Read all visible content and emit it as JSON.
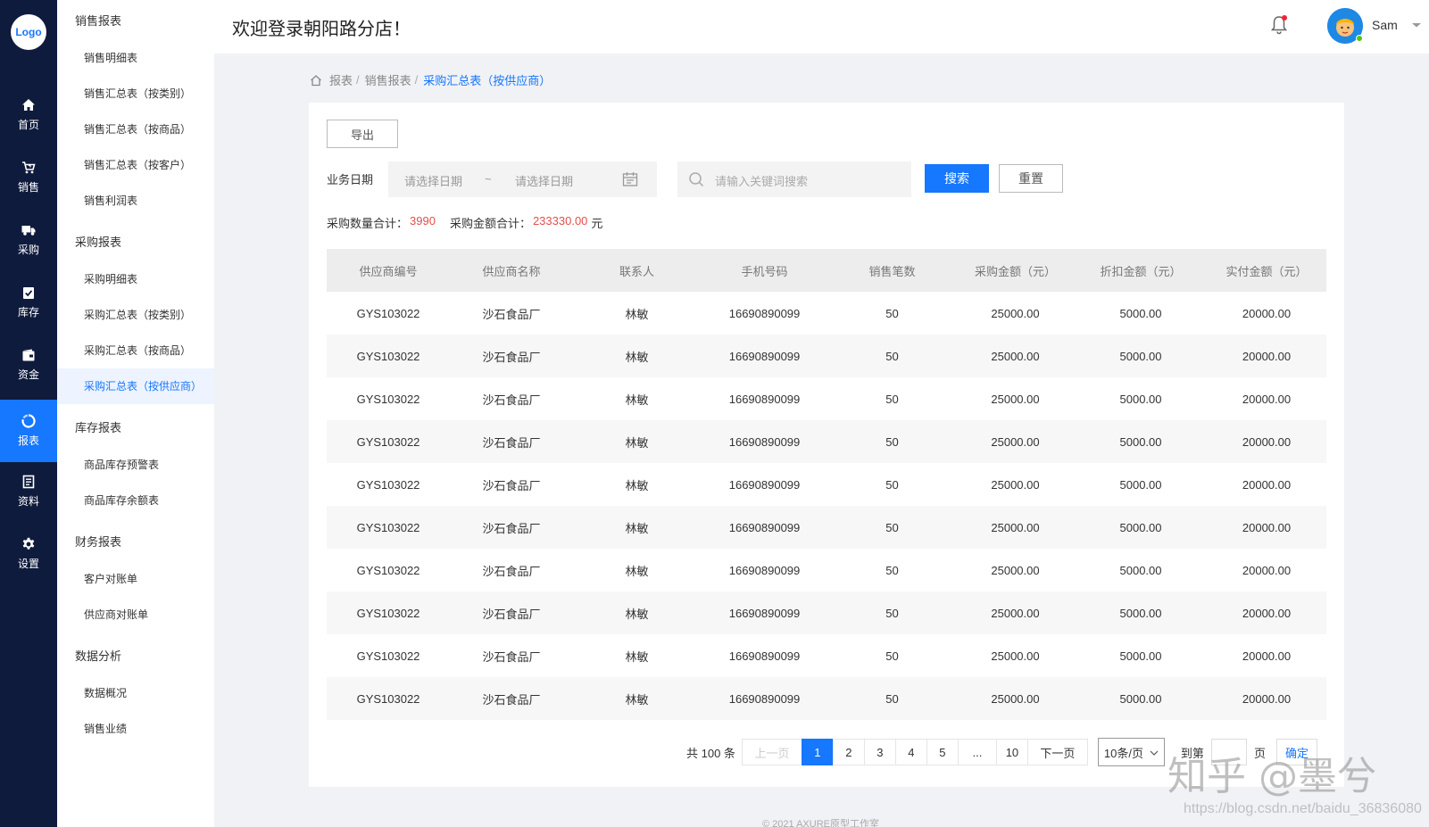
{
  "logo": "Logo",
  "rail": [
    {
      "label": "首页",
      "icon": "home-icon"
    },
    {
      "label": "销售",
      "icon": "cart-icon"
    },
    {
      "label": "采购",
      "icon": "truck-icon"
    },
    {
      "label": "库存",
      "icon": "clipboard-check-icon"
    },
    {
      "label": "资金",
      "icon": "wallet-icon"
    },
    {
      "label": "报表",
      "icon": "chart-ring-icon"
    },
    {
      "label": "资料",
      "icon": "document-icon"
    },
    {
      "label": "设置",
      "icon": "gear-icon"
    }
  ],
  "submenu": {
    "groups": [
      {
        "title": "销售报表",
        "items": [
          "销售明细表",
          "销售汇总表（按类别）",
          "销售汇总表（按商品）",
          "销售汇总表（按客户）",
          "销售利润表"
        ]
      },
      {
        "title": "采购报表",
        "items": [
          "采购明细表",
          "采购汇总表（按类别）",
          "采购汇总表（按商品）",
          "采购汇总表（按供应商）"
        ]
      },
      {
        "title": "库存报表",
        "items": [
          "商品库存预警表",
          "商品库存余额表"
        ]
      },
      {
        "title": "财务报表",
        "items": [
          "客户对账单",
          "供应商对账单"
        ]
      },
      {
        "title": "数据分析",
        "items": [
          "数据概况",
          "销售业绩"
        ]
      }
    ]
  },
  "header": {
    "welcome": "欢迎登录朝阳路分店！",
    "username": "Sam"
  },
  "breadcrumb": [
    "报表",
    "销售报表",
    "采购汇总表（按供应商）"
  ],
  "toolbar": {
    "export": "导出"
  },
  "filters": {
    "date_label": "业务日期",
    "start_placeholder": "请选择日期",
    "tilde": "~",
    "end_placeholder": "请选择日期",
    "search_placeholder": "请输入关键词搜索",
    "search_btn": "搜索",
    "reset_btn": "重置"
  },
  "summary": {
    "qty_label": "采购数量合计：",
    "qty_value": "3990",
    "amount_label": "采购金额合计：",
    "amount_value": "233330.00",
    "unit": "元"
  },
  "table": {
    "columns": [
      "供应商编号",
      "供应商名称",
      "联系人",
      "手机号码",
      "销售笔数",
      "采购金额（元）",
      "折扣金额（元）",
      "实付金额（元）"
    ],
    "rows": [
      [
        "GYS103022",
        "沙石食品厂",
        "林敏",
        "16690890099",
        "50",
        "25000.00",
        "5000.00",
        "20000.00"
      ],
      [
        "GYS103022",
        "沙石食品厂",
        "林敏",
        "16690890099",
        "50",
        "25000.00",
        "5000.00",
        "20000.00"
      ],
      [
        "GYS103022",
        "沙石食品厂",
        "林敏",
        "16690890099",
        "50",
        "25000.00",
        "5000.00",
        "20000.00"
      ],
      [
        "GYS103022",
        "沙石食品厂",
        "林敏",
        "16690890099",
        "50",
        "25000.00",
        "5000.00",
        "20000.00"
      ],
      [
        "GYS103022",
        "沙石食品厂",
        "林敏",
        "16690890099",
        "50",
        "25000.00",
        "5000.00",
        "20000.00"
      ],
      [
        "GYS103022",
        "沙石食品厂",
        "林敏",
        "16690890099",
        "50",
        "25000.00",
        "5000.00",
        "20000.00"
      ],
      [
        "GYS103022",
        "沙石食品厂",
        "林敏",
        "16690890099",
        "50",
        "25000.00",
        "5000.00",
        "20000.00"
      ],
      [
        "GYS103022",
        "沙石食品厂",
        "林敏",
        "16690890099",
        "50",
        "25000.00",
        "5000.00",
        "20000.00"
      ],
      [
        "GYS103022",
        "沙石食品厂",
        "林敏",
        "16690890099",
        "50",
        "25000.00",
        "5000.00",
        "20000.00"
      ],
      [
        "GYS103022",
        "沙石食品厂",
        "林敏",
        "16690890099",
        "50",
        "25000.00",
        "5000.00",
        "20000.00"
      ]
    ]
  },
  "pagination": {
    "total": "共 100 条",
    "prev": "上一页",
    "pages": [
      "1",
      "2",
      "3",
      "4",
      "5",
      "...",
      "10"
    ],
    "next": "下一页",
    "page_size": "10条/页",
    "goto_label": "到第",
    "goto_unit": "页",
    "goto_btn": "确定"
  },
  "footer": "© 2021   AXURE原型工作室",
  "watermark": {
    "text": "知乎 @墨兮",
    "url": "https://blog.csdn.net/baidu_36836080"
  },
  "colors": {
    "primary": "#1677ff",
    "rail": "#0f1b3d",
    "highlight": "#e0504d"
  }
}
